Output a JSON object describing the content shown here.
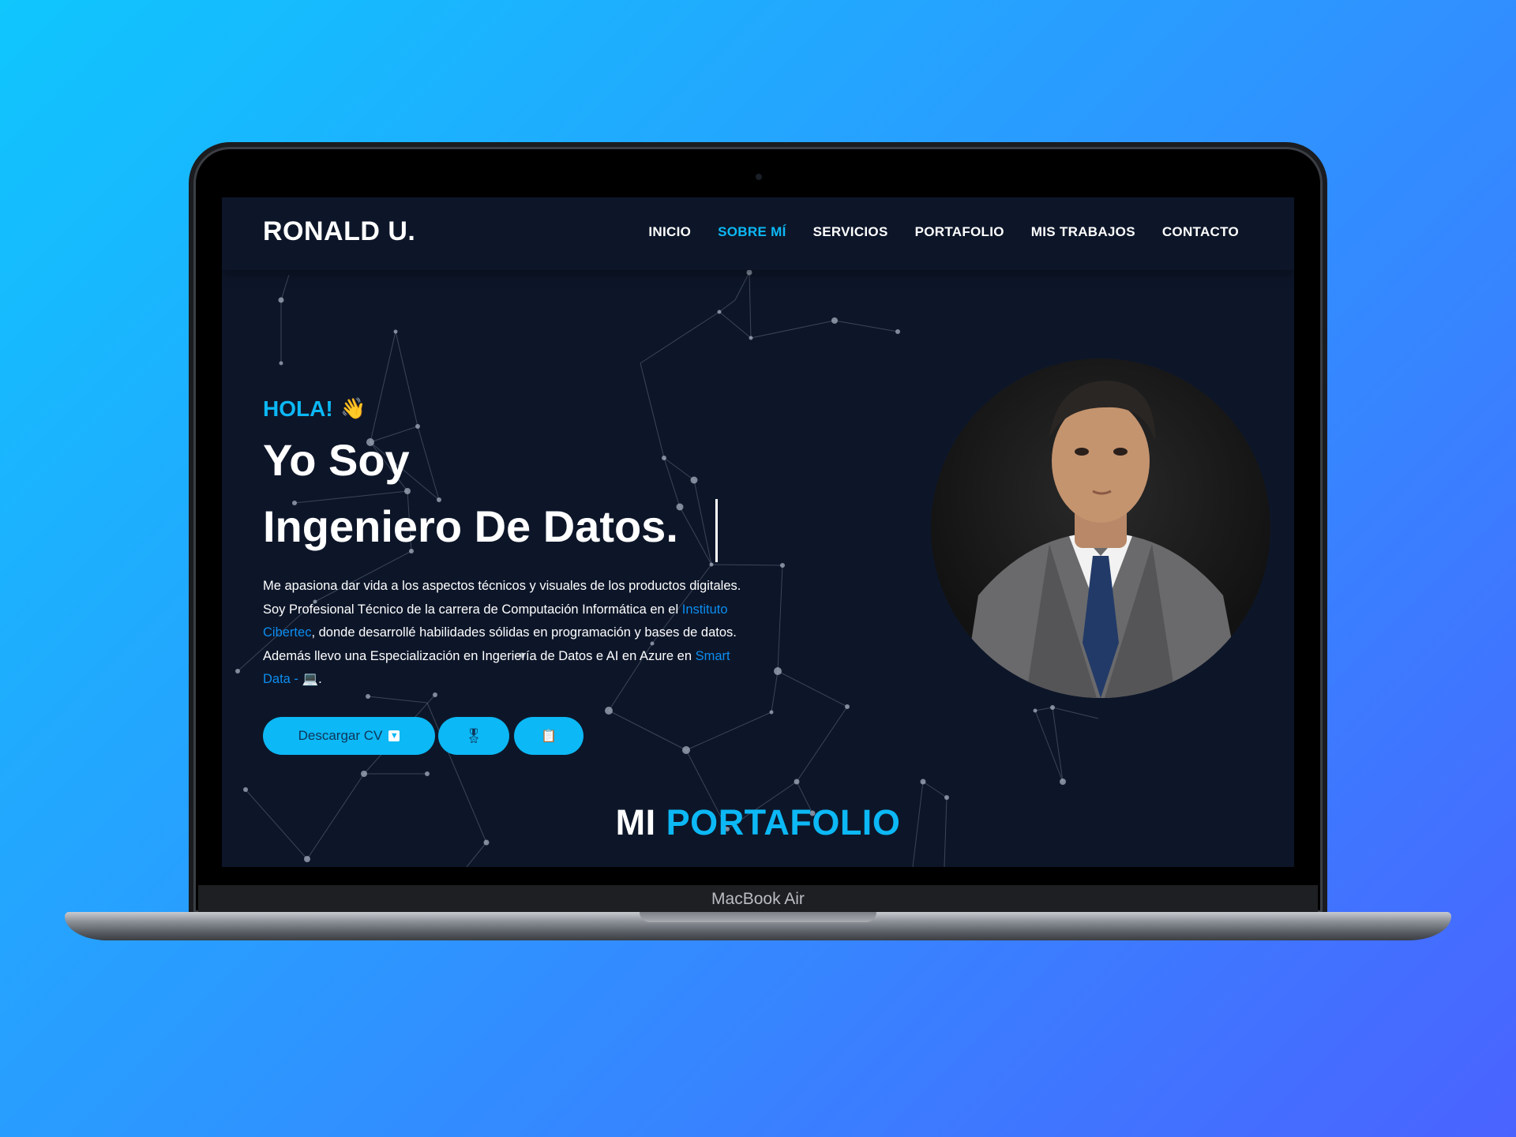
{
  "device": {
    "label": "MacBook Air"
  },
  "site": {
    "logo": "RONALD U.",
    "nav": [
      {
        "label": "INICIO",
        "active": false
      },
      {
        "label": "SOBRE MÍ",
        "active": true
      },
      {
        "label": "SERVICIOS",
        "active": false
      },
      {
        "label": "PORTAFOLIO",
        "active": false
      },
      {
        "label": "MIS TRABAJOS",
        "active": false
      },
      {
        "label": "CONTACTO",
        "active": false
      }
    ]
  },
  "hero": {
    "greeting": "HOLA!",
    "greeting_emoji": "👋",
    "line1": "Yo Soy",
    "line2": "Ingeniero De Datos.",
    "para": {
      "p1": "Me apasiona dar vida a los aspectos técnicos y visuales de los productos digitales. Soy Profesional Técnico de la carrera de Computación Informática en el ",
      "link1": "Instituto Cibertec",
      "p2": ", donde desarrollé habilidades sólidas en programación y bases de datos. Además llevo una Especialización en Ingeriería de Datos e AI en Azure en ",
      "link2": "Smart Data - ",
      "emoji": "💻",
      "p3": "."
    },
    "buttons": {
      "cv_label": "Descargar CV",
      "cv_icon": "▼",
      "medal_icon": "🎖",
      "doc_icon": "📋"
    }
  },
  "portfolio": {
    "word1": "MI",
    "word2": "PORTAFOLIO"
  },
  "colors": {
    "accent": "#0cb8f5",
    "bg": "#0d1629",
    "link": "#0c8df0"
  }
}
